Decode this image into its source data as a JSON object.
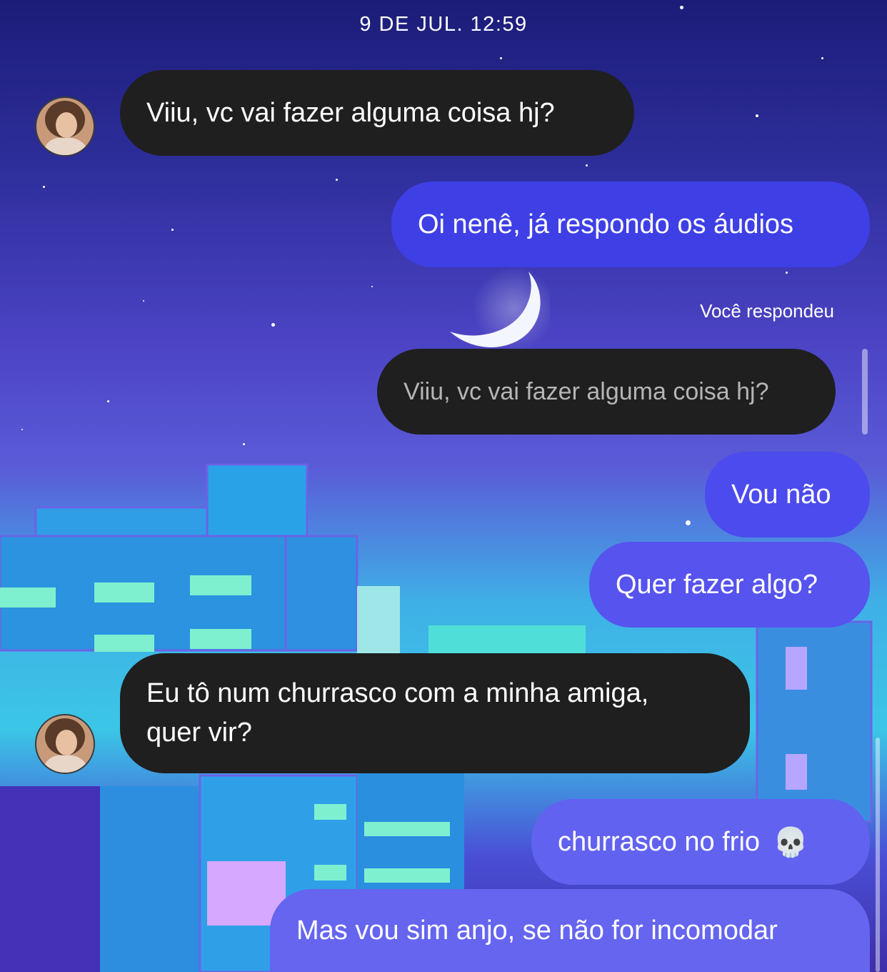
{
  "timestamp": "9 DE JUL. 12:59",
  "contact": {
    "avatar_icon": "contact-avatar"
  },
  "messages": [
    {
      "direction": "incoming",
      "text": "Viiu, vc vai fazer alguma coisa hj?"
    },
    {
      "direction": "outgoing",
      "text": "Oi nenê, já respondo os áudios"
    },
    {
      "direction": "outgoing",
      "reply_label": "Você respondeu",
      "quoted_text": "Viiu, vc vai fazer alguma coisa hj?"
    },
    {
      "direction": "outgoing",
      "text": "Vou não"
    },
    {
      "direction": "outgoing",
      "text": "Quer fazer algo?"
    },
    {
      "direction": "incoming",
      "line1": "Eu tô num churrasco com a minha amiga,",
      "line2": "quer vir?"
    },
    {
      "direction": "outgoing",
      "text": "churrasco no frio",
      "emoji": "💀"
    },
    {
      "direction": "outgoing",
      "text": "Mas vou sim anjo, se não for incomodar"
    }
  ],
  "colors": {
    "incoming_bubble": "#1f1f1f",
    "outgoing_1": "#3f3fe6",
    "outgoing_2": "#5653ee",
    "outgoing_3": "#6565f0"
  }
}
